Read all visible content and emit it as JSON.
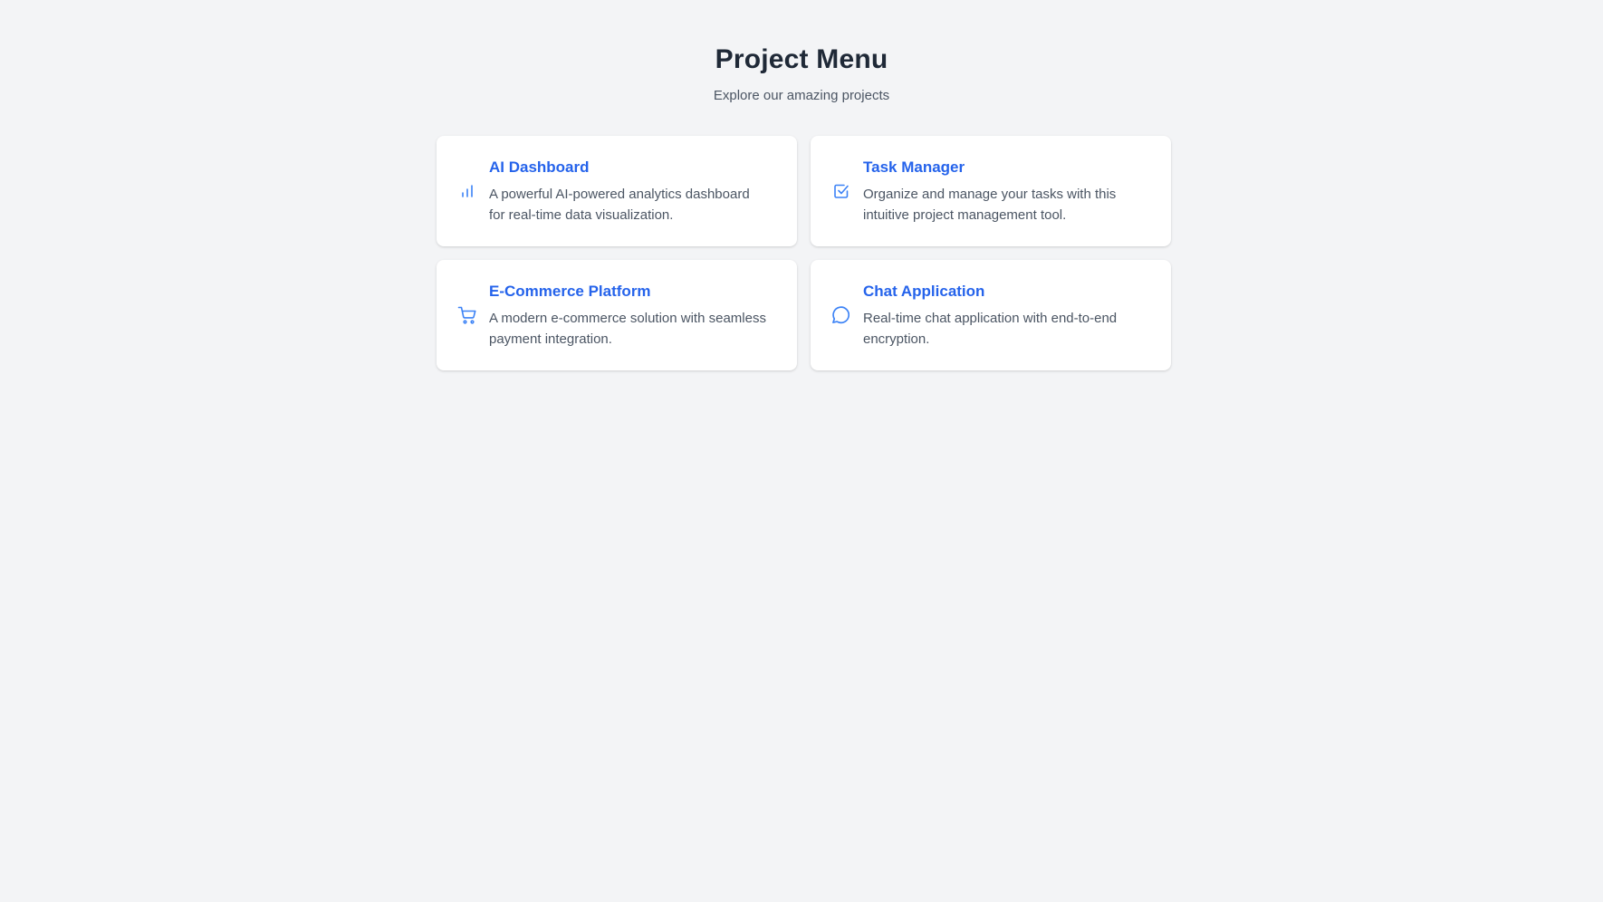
{
  "header": {
    "title": "Project Menu",
    "subtitle": "Explore our amazing projects"
  },
  "colors": {
    "background": "#f3f4f6",
    "accent": "#2563eb",
    "icon": "#3b82f6",
    "title_text": "#1f2937",
    "body_text": "#4b5563",
    "card": "#ffffff"
  },
  "projects": [
    {
      "icon": "bar-chart-icon",
      "title": "AI Dashboard",
      "description_line1": "A powerful AI-powered analytics dashboard",
      "description_line2": "for real-time data visualization."
    },
    {
      "icon": "checkbox-icon",
      "title": "Task Manager",
      "description_line1": "Organize and manage your tasks with this",
      "description_line2": "intuitive project management tool."
    },
    {
      "icon": "shopping-cart-icon",
      "title": "E-Commerce Platform",
      "description_line1": "A modern e-commerce solution with seamless",
      "description_line2": "payment integration."
    },
    {
      "icon": "chat-bubble-icon",
      "title": "Chat Application",
      "description_line1": "Real-time chat application with end-to-end",
      "description_line2": "encryption."
    }
  ]
}
